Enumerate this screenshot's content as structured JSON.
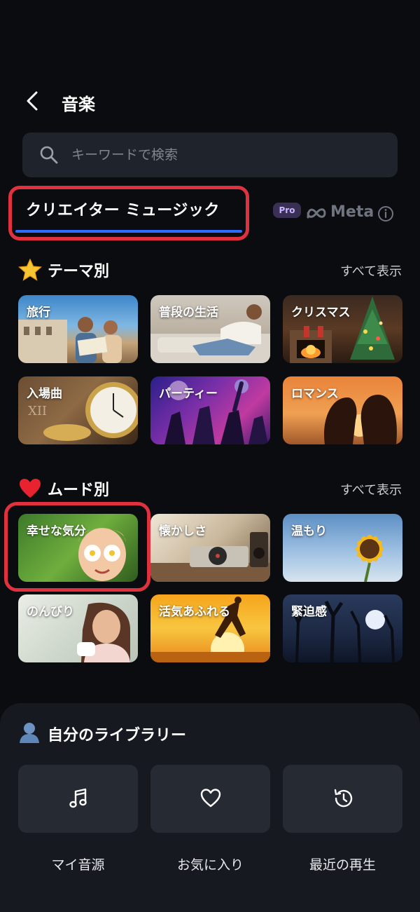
{
  "header": {
    "title": "音楽"
  },
  "search": {
    "placeholder": "キーワードで検索"
  },
  "tabs": {
    "creator_music": "クリエイター ミュージック",
    "pro_badge": "Pro",
    "meta": "Meta"
  },
  "theme_section": {
    "emoji": "star-emoji",
    "title": "テーマ別",
    "see_all": "すべて表示",
    "items": [
      {
        "label": "旅行"
      },
      {
        "label": "普段の生活"
      },
      {
        "label": "クリスマス"
      },
      {
        "label": "入場曲"
      },
      {
        "label": "パーティー"
      },
      {
        "label": "ロマンス"
      }
    ]
  },
  "mood_section": {
    "emoji": "heart-emoji",
    "title": "ムード別",
    "see_all": "すべて表示",
    "items": [
      {
        "label": "幸せな気分"
      },
      {
        "label": "懐かしさ"
      },
      {
        "label": "温もり"
      },
      {
        "label": "のんびり"
      },
      {
        "label": "活気あふれる"
      },
      {
        "label": "緊迫感"
      }
    ]
  },
  "library": {
    "title": "自分のライブラリー",
    "items": [
      {
        "label": "マイ音源",
        "icon": "music-note-icon"
      },
      {
        "label": "お気に入り",
        "icon": "heart-icon"
      },
      {
        "label": "最近の再生",
        "icon": "history-icon"
      }
    ]
  },
  "colors": {
    "background": "#0b0c0f",
    "highlight": "#e0323e",
    "tab_underline": "#2f6dff",
    "surface": "#1f232b"
  }
}
